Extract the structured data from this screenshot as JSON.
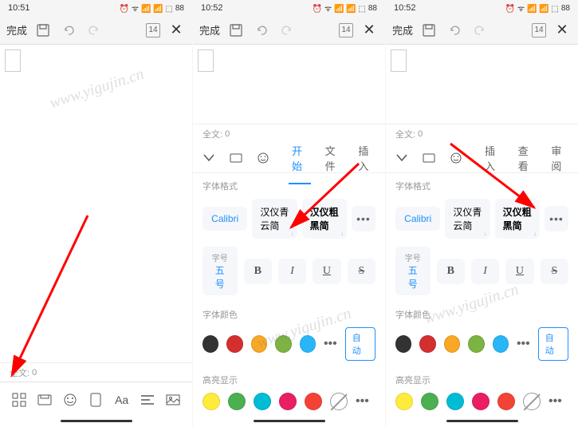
{
  "status": {
    "time1": "10:51",
    "time2": "10:52",
    "time3": "10:52",
    "battery": "88"
  },
  "toolbar": {
    "done": "完成",
    "page": "14"
  },
  "wordcount": {
    "label": "全文:",
    "value": "0"
  },
  "tabs": {
    "start": "开始",
    "file": "文件",
    "insert": "插入",
    "view": "查看",
    "review": "审阅"
  },
  "sections": {
    "fontStyle": "字体格式",
    "fontColor": "字体颜色",
    "highlight": "高亮显示",
    "sizeLabel": "字号",
    "sizeValue": "五号"
  },
  "fonts": {
    "calibri": "Calibri",
    "hanyi1": "汉仪青云简",
    "hanyi2": "汉仪粗黑简"
  },
  "styleBtns": {
    "bold": "B",
    "italic": "I",
    "underline": "U",
    "strike": "S"
  },
  "auto": "自动",
  "colors": {
    "font": [
      "#333333",
      "#d32f2f",
      "#f9a825",
      "#7cb342",
      "#29b6f6"
    ],
    "highlight": [
      "#ffeb3b",
      "#4caf50",
      "#00bcd4",
      "#e91e63",
      "#f44336"
    ]
  },
  "watermark": "www.yigujin.cn"
}
